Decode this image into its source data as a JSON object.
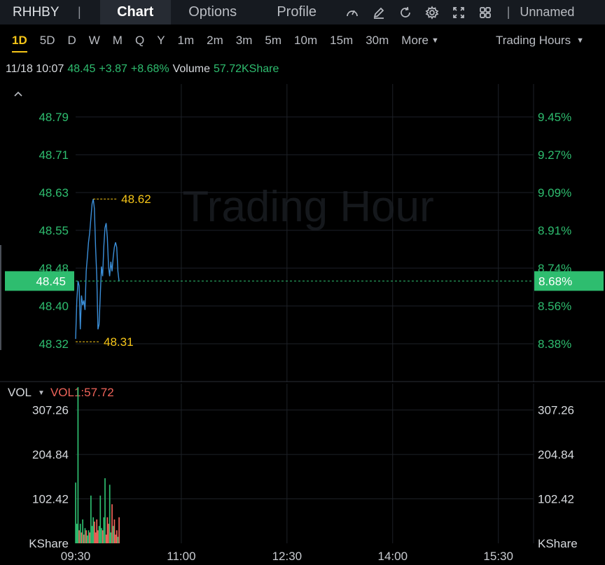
{
  "header": {
    "ticker": "RHHBY",
    "tabs": [
      {
        "label": "Chart",
        "active": true
      },
      {
        "label": "Options",
        "active": false
      },
      {
        "label": "Profile",
        "active": false
      }
    ],
    "tool_icons": [
      "speedometer-icon",
      "pen-icon",
      "refresh-icon",
      "gear-icon",
      "fullscreen-icon",
      "layout-grid-icon"
    ],
    "layout_name": "Unnamed"
  },
  "periods": [
    "1D",
    "5D",
    "D",
    "W",
    "M",
    "Q",
    "Y",
    "1m",
    "2m",
    "3m",
    "5m",
    "10m",
    "15m",
    "30m"
  ],
  "active_period": "1D",
  "more_label": "More",
  "trading_hours_label": "Trading Hours",
  "quote": {
    "datetime": "11/18 10:07",
    "price": "48.45",
    "change": "+3.87",
    "change_pct": "+8.68%",
    "volume_label": "Volume",
    "volume": "57.72KShare"
  },
  "watermark": "Trading Hour",
  "colors": {
    "up": "#2ebd6f",
    "down": "#f0645a",
    "line": "#3b8fd9",
    "marker": "#f5c518",
    "grid": "#1d2127"
  },
  "chart_data": [
    {
      "type": "line",
      "y_ticks_left": [
        "48.79",
        "48.71",
        "48.63",
        "48.55",
        "48.48",
        "48.40",
        "48.32"
      ],
      "y_ticks_right": [
        "9.45%",
        "9.27%",
        "9.09%",
        "8.91%",
        "8.74%",
        "8.56%",
        "8.38%"
      ],
      "ylim": [
        48.32,
        48.79
      ],
      "current_price_tag": "48.45",
      "current_pct_tag": "8.68%",
      "max_label": "48.62",
      "min_label": "48.31",
      "x_ticks": [
        "09:30",
        "11:00",
        "12:30",
        "14:00",
        "15:30"
      ],
      "x_range_minutes": [
        0,
        390
      ],
      "x_minutes": [
        0,
        1,
        2,
        3,
        4,
        5,
        6,
        7,
        8,
        9,
        10,
        11,
        12,
        13,
        14,
        15,
        16,
        17,
        18,
        19,
        20,
        21,
        22,
        23,
        24,
        25,
        26,
        27,
        28,
        29,
        30,
        31,
        32,
        33,
        34,
        35,
        36,
        37
      ],
      "values": [
        48.33,
        48.41,
        48.45,
        48.44,
        48.35,
        48.42,
        48.4,
        48.41,
        48.39,
        48.47,
        48.5,
        48.53,
        48.55,
        48.58,
        48.61,
        48.62,
        48.6,
        48.52,
        48.46,
        48.35,
        48.36,
        48.42,
        48.48,
        48.46,
        48.52,
        48.56,
        48.57,
        48.54,
        48.48,
        48.46,
        48.49,
        48.47,
        48.5,
        48.52,
        48.53,
        48.52,
        48.47,
        48.45
      ]
    },
    {
      "type": "bar",
      "title": "VOL",
      "indicator_label": "VOL1:57.72",
      "y_ticks": [
        "307.26",
        "204.84",
        "102.42"
      ],
      "unit": "KShare",
      "ylim": [
        0,
        368
      ],
      "x_minutes": [
        0,
        1,
        2,
        3,
        4,
        5,
        6,
        7,
        8,
        9,
        10,
        11,
        12,
        13,
        14,
        15,
        16,
        17,
        18,
        19,
        20,
        21,
        22,
        23,
        24,
        25,
        26,
        27,
        28,
        29,
        30,
        31,
        32,
        33,
        34,
        35,
        36,
        37
      ],
      "values": [
        140,
        45,
        360,
        30,
        45,
        25,
        55,
        20,
        35,
        30,
        18,
        30,
        25,
        110,
        40,
        60,
        50,
        25,
        55,
        30,
        40,
        110,
        35,
        30,
        60,
        150,
        20,
        60,
        45,
        135,
        25,
        90,
        40,
        55,
        20,
        30,
        15,
        60
      ],
      "directions": [
        "up",
        "up",
        "up",
        "down",
        "up",
        "down",
        "up",
        "down",
        "up",
        "down",
        "up",
        "up",
        "down",
        "up",
        "up",
        "up",
        "down",
        "down",
        "down",
        "down",
        "up",
        "up",
        "up",
        "down",
        "up",
        "up",
        "down",
        "down",
        "down",
        "up",
        "up",
        "down",
        "up",
        "down",
        "down",
        "down",
        "up",
        "down"
      ]
    }
  ]
}
